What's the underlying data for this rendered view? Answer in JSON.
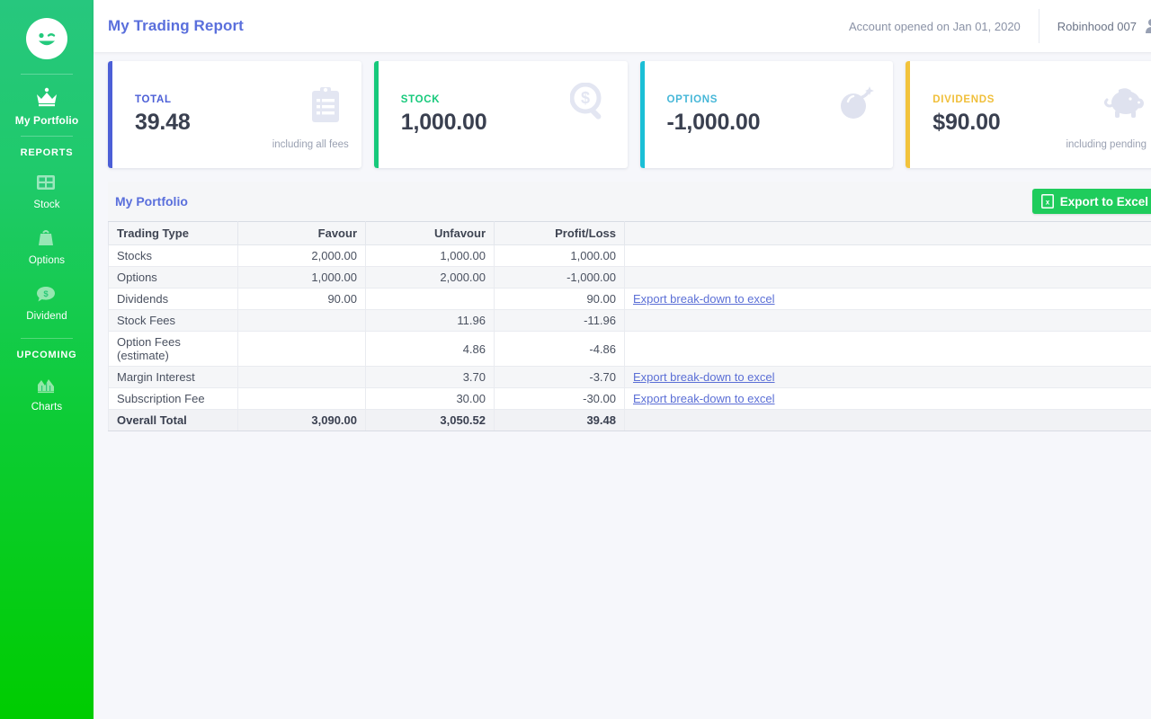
{
  "sidebar": {
    "logo_icon": "winking-face-logo",
    "primary": [
      {
        "label": "My Portfolio",
        "icon": "crown-icon",
        "active": true
      }
    ],
    "sections": [
      {
        "title": "REPORTS",
        "items": [
          {
            "label": "Stock",
            "icon": "grid-icon"
          },
          {
            "label": "Options",
            "icon": "bag-icon"
          },
          {
            "label": "Dividend",
            "icon": "dollar-bubble-icon"
          }
        ]
      },
      {
        "title": "UPCOMING",
        "items": [
          {
            "label": "Charts",
            "icon": "area-chart-icon"
          }
        ]
      }
    ]
  },
  "topbar": {
    "title": "My Trading Report",
    "account_opened": "Account opened on Jan 01, 2020",
    "user_name": "Robinhood 007",
    "user_icon": "user-avatar-icon"
  },
  "cards": [
    {
      "title": "TOTAL",
      "value": "39.48",
      "note": "including all fees",
      "accent": "#4c5fd7",
      "title_color": "#4c5fd7",
      "icon": "clipboard-list-icon"
    },
    {
      "title": "STOCK",
      "value": "1,000.00",
      "note": "",
      "accent": "#16c97b",
      "title_color": "#16c97b",
      "icon": "dollar-magnifier-icon"
    },
    {
      "title": "OPTIONS",
      "value": "-1,000.00",
      "note": "",
      "accent": "#1bbfd6",
      "title_color": "#46b7d8",
      "icon": "bomb-icon"
    },
    {
      "title": "DIVIDENDS",
      "value": "$90.00",
      "note": "including pending",
      "accent": "#f2c33c",
      "title_color": "#f0bf3a",
      "icon": "piggy-bank-icon"
    }
  ],
  "panel": {
    "title": "My Portfolio",
    "export_button": "Export to Excel",
    "export_icon": "excel-file-icon"
  },
  "table": {
    "headers": [
      "Trading Type",
      "Favour",
      "Unfavour",
      "Profit/Loss",
      ""
    ],
    "rows": [
      {
        "type": "Stocks",
        "favour": "2,000.00",
        "unfavour": "1,000.00",
        "pl": "1,000.00",
        "link": ""
      },
      {
        "type": "Options",
        "favour": "1,000.00",
        "unfavour": "2,000.00",
        "pl": "-1,000.00",
        "link": ""
      },
      {
        "type": "Dividends",
        "favour": "90.00",
        "unfavour": "",
        "pl": "90.00",
        "link": "Export break-down to excel"
      },
      {
        "type": "Stock Fees",
        "favour": "",
        "unfavour": "11.96",
        "pl": "-11.96",
        "link": ""
      },
      {
        "type": "Option Fees (estimate)",
        "favour": "",
        "unfavour": "4.86",
        "pl": "-4.86",
        "link": ""
      },
      {
        "type": "Margin Interest",
        "favour": "",
        "unfavour": "3.70",
        "pl": "-3.70",
        "link": "Export break-down to excel"
      },
      {
        "type": "Subscription Fee",
        "favour": "",
        "unfavour": "30.00",
        "pl": "-30.00",
        "link": "Export break-down to excel"
      }
    ],
    "total": {
      "type": "Overall Total",
      "favour": "3,090.00",
      "unfavour": "3,050.52",
      "pl": "39.48",
      "link": ""
    }
  }
}
